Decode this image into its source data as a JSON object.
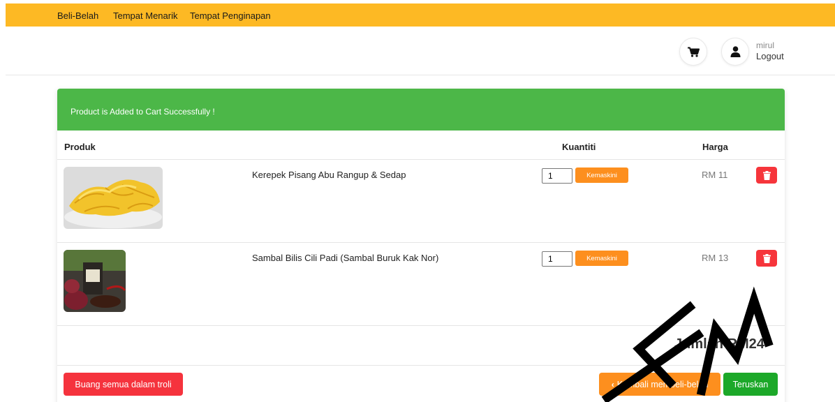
{
  "nav": {
    "items": [
      "Beli-Belah",
      "Tempat Menarik",
      "Tempat Penginapan"
    ]
  },
  "header": {
    "username": "mirul",
    "logout": "Logout"
  },
  "alert": {
    "message": "Product is Added to Cart Successfully !"
  },
  "table": {
    "headers": {
      "product": "Produk",
      "quantity": "Kuantiti",
      "price": "Harga"
    },
    "rows": [
      {
        "name": "Kerepek Pisang Abu Rangup & Sedap",
        "quantity": "1",
        "update": "Kemaskini",
        "price": "RM 11"
      },
      {
        "name": "Sambal Bilis Cili Padi (Sambal Buruk Kak Nor)",
        "quantity": "1",
        "update": "Kemaskini",
        "price": "RM 13"
      }
    ]
  },
  "total": "Jumlah RM24",
  "actions": {
    "clear": "Buang semua dalam troli",
    "back": "Kembali membeli-belah",
    "checkout": "Teruskan"
  },
  "colors": {
    "nav": "#fdb924",
    "alert": "#4cb748",
    "orange": "#fd8f1e",
    "red": "#f5333d",
    "green": "#1ca829"
  },
  "icons": [
    "shopping-cart-icon",
    "user-icon",
    "trash-icon",
    "chevron-left-icon"
  ]
}
